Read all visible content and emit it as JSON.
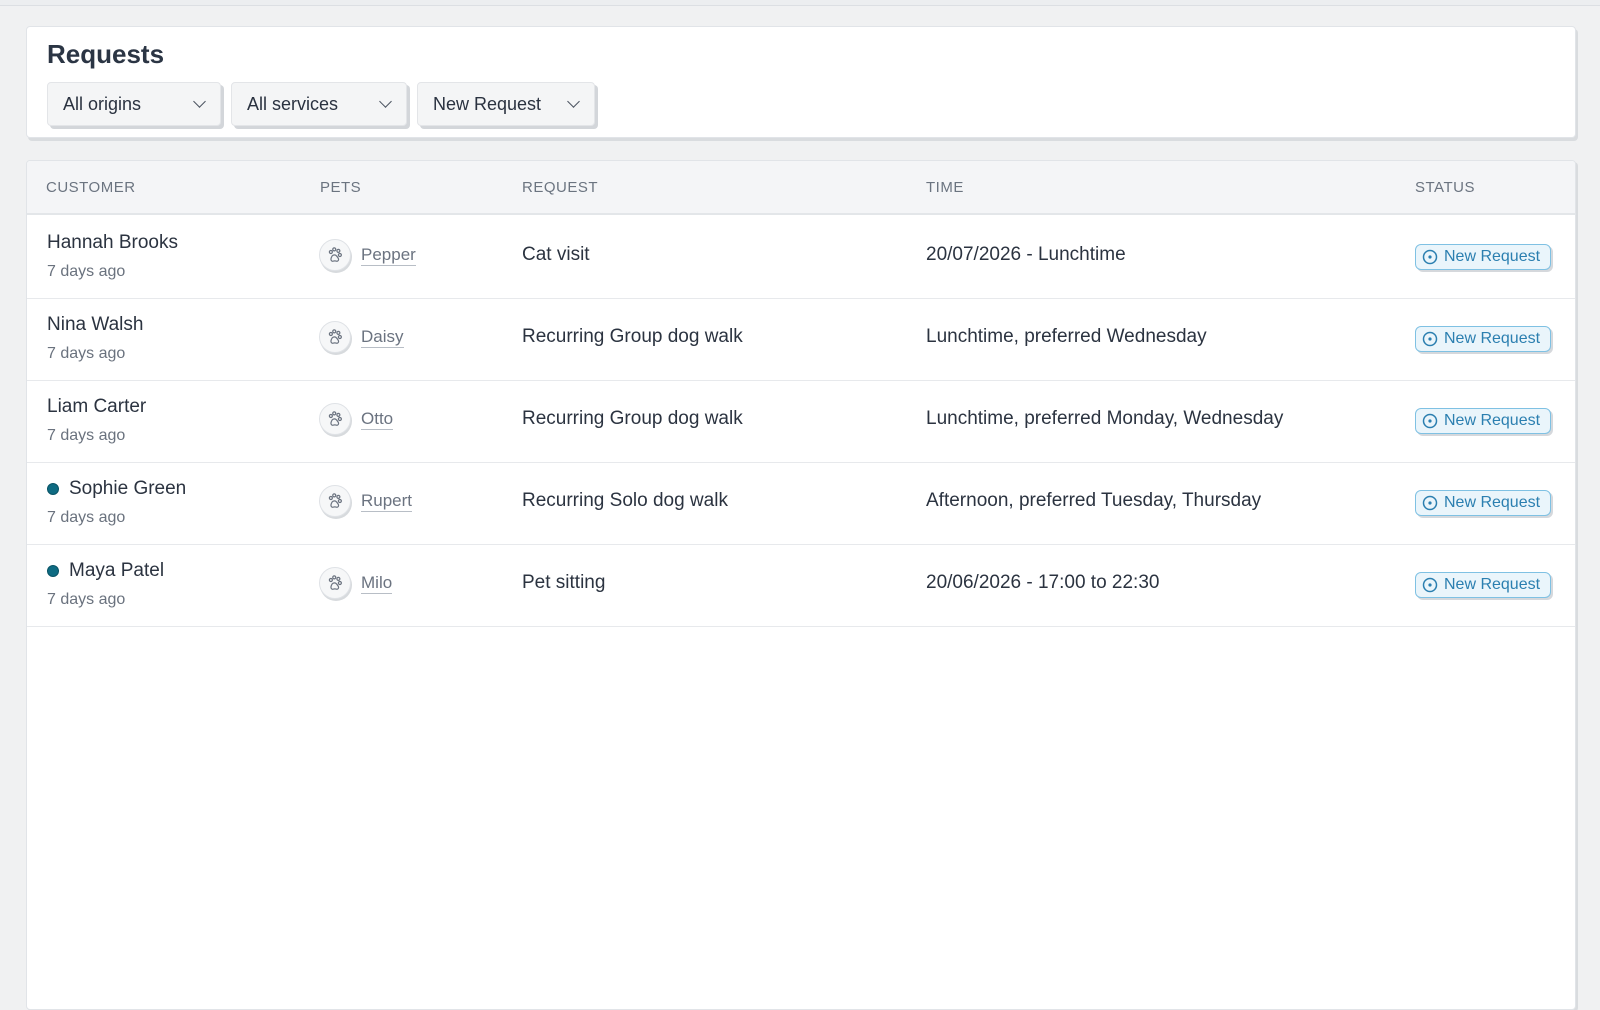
{
  "page": {
    "title": "Requests"
  },
  "filters": {
    "origins": "All origins",
    "services": "All services",
    "status": "New Request"
  },
  "table": {
    "headers": {
      "customer": "CUSTOMER",
      "pets": "PETS",
      "request": "REQUEST",
      "time": "TIME",
      "status": "STATUS"
    },
    "rows": [
      {
        "customer": "Hannah Brooks",
        "ago": "7 days ago",
        "pet": "Pepper",
        "request": "Cat visit",
        "time": "20/07/2026 - Lunchtime",
        "status": "New Request",
        "unread": false
      },
      {
        "customer": "Nina Walsh",
        "ago": "7 days ago",
        "pet": "Daisy",
        "request": "Recurring Group dog walk",
        "time": "Lunchtime, preferred Wednesday",
        "status": "New Request",
        "unread": false
      },
      {
        "customer": "Liam Carter",
        "ago": "7 days ago",
        "pet": "Otto",
        "request": "Recurring Group dog walk",
        "time": "Lunchtime, preferred Monday, Wednesday",
        "status": "New Request",
        "unread": false
      },
      {
        "customer": "Sophie Green",
        "ago": "7 days ago",
        "pet": "Rupert",
        "request": "Recurring Solo dog walk",
        "time": "Afternoon, preferred Tuesday, Thursday",
        "status": "New Request",
        "unread": true
      },
      {
        "customer": "Maya Patel",
        "ago": "7 days ago",
        "pet": "Milo",
        "request": "Pet sitting",
        "time": "20/06/2026 - 17:00 to 22:30",
        "status": "New Request",
        "unread": true
      }
    ]
  },
  "icons": {
    "pet": "paw-icon",
    "status": "clock-circle-icon",
    "dropdown": "chevron-down-icon",
    "unread": "unread-dot-icon"
  },
  "colors": {
    "unread_dot": "#0e6b82",
    "status_text": "#2b7fb0",
    "status_bg": "#eaf5fb",
    "status_border": "#7fc1e3"
  }
}
